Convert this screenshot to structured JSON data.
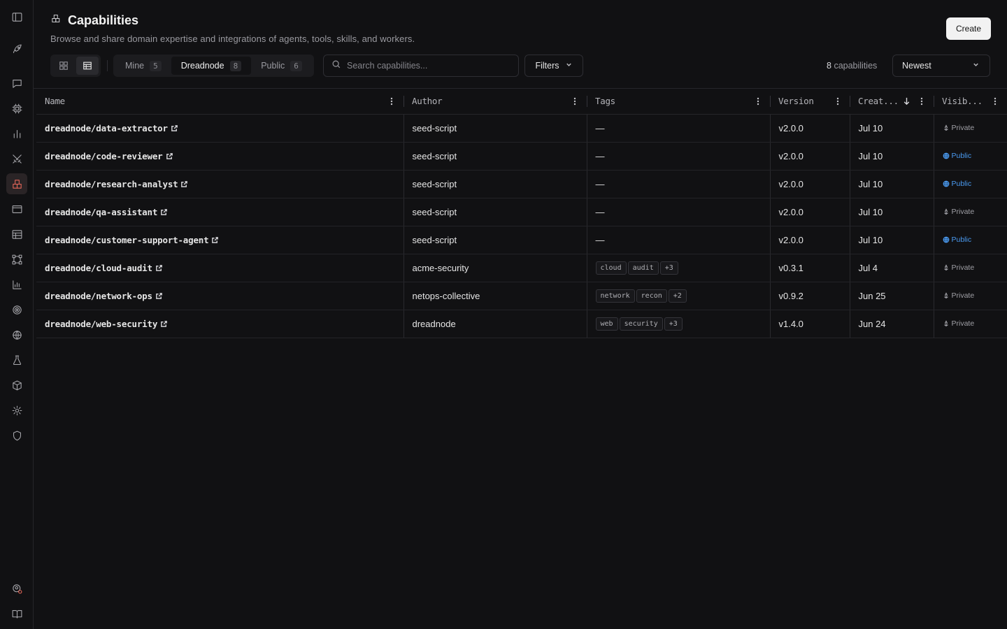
{
  "page": {
    "title": "Capabilities",
    "subtitle": "Browse and share domain expertise and integrations of agents, tools, skills, and workers.",
    "create_label": "Create"
  },
  "colors": {
    "background": "#111113",
    "accent": "#e8685a",
    "public": "#4a9af0",
    "private": "#a0a0a6"
  },
  "sidebar": {
    "items": [
      {
        "icon": "sidebar-toggle-icon"
      },
      {
        "icon": "rocket-icon"
      },
      {
        "icon": "chat-icon"
      },
      {
        "icon": "chip-icon"
      },
      {
        "icon": "bar-chart-icon"
      },
      {
        "icon": "swords-icon"
      },
      {
        "icon": "capabilities-icon",
        "active": true
      },
      {
        "icon": "browser-window-icon"
      },
      {
        "icon": "table-icon"
      },
      {
        "icon": "workflow-icon"
      },
      {
        "icon": "analytics-icon"
      },
      {
        "icon": "target-icon"
      },
      {
        "icon": "globe-icon"
      },
      {
        "icon": "flask-icon"
      },
      {
        "icon": "package-icon"
      },
      {
        "icon": "gear-icon"
      },
      {
        "icon": "shield-icon"
      },
      {
        "icon": "user-settings-icon"
      },
      {
        "icon": "book-icon"
      }
    ]
  },
  "toolbar": {
    "scope_tabs": [
      {
        "label": "Mine",
        "count": "5",
        "active": false
      },
      {
        "label": "Dreadnode",
        "count": "8",
        "active": true
      },
      {
        "label": "Public",
        "count": "6",
        "active": false
      }
    ],
    "search_placeholder": "Search capabilities...",
    "filters_label": "Filters",
    "count_number": "8",
    "count_label": "capabilities",
    "sort_value": "Newest"
  },
  "table": {
    "columns": [
      "Name",
      "Author",
      "Tags",
      "Version",
      "Creat...",
      "Visib..."
    ],
    "rows": [
      {
        "name": "dreadnode/data-extractor",
        "author": "seed-script",
        "tags": [],
        "tags_more": "",
        "version": "v2.0.0",
        "created": "Jul 10",
        "visibility": "Private"
      },
      {
        "name": "dreadnode/code-reviewer",
        "author": "seed-script",
        "tags": [],
        "tags_more": "",
        "version": "v2.0.0",
        "created": "Jul 10",
        "visibility": "Public"
      },
      {
        "name": "dreadnode/research-analyst",
        "author": "seed-script",
        "tags": [],
        "tags_more": "",
        "version": "v2.0.0",
        "created": "Jul 10",
        "visibility": "Public"
      },
      {
        "name": "dreadnode/qa-assistant",
        "author": "seed-script",
        "tags": [],
        "tags_more": "",
        "version": "v2.0.0",
        "created": "Jul 10",
        "visibility": "Private"
      },
      {
        "name": "dreadnode/customer-support-agent",
        "author": "seed-script",
        "tags": [],
        "tags_more": "",
        "version": "v2.0.0",
        "created": "Jul 10",
        "visibility": "Public"
      },
      {
        "name": "dreadnode/cloud-audit",
        "author": "acme-security",
        "tags": [
          "cloud",
          "audit"
        ],
        "tags_more": "+3",
        "version": "v0.3.1",
        "created": "Jul 4",
        "visibility": "Private"
      },
      {
        "name": "dreadnode/network-ops",
        "author": "netops-collective",
        "tags": [
          "network",
          "recon"
        ],
        "tags_more": "+2",
        "version": "v0.9.2",
        "created": "Jun 25",
        "visibility": "Private"
      },
      {
        "name": "dreadnode/web-security",
        "author": "dreadnode",
        "tags": [
          "web",
          "security"
        ],
        "tags_more": "+3",
        "version": "v1.4.0",
        "created": "Jun 24",
        "visibility": "Private"
      }
    ],
    "empty_tags": "—"
  }
}
